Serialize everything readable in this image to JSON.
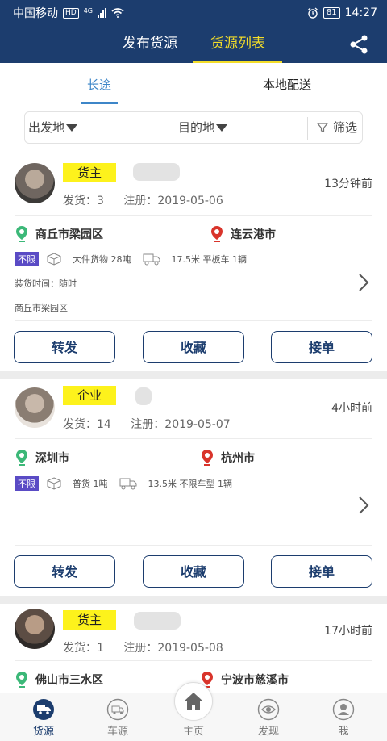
{
  "status_bar": {
    "carrier": "中国移动",
    "hd": "HD",
    "network": "4G",
    "battery": "81",
    "time": "14:27"
  },
  "header": {
    "tabs": [
      {
        "label": "发布货源"
      },
      {
        "label": "货源列表"
      }
    ],
    "active_tab": "货源列表",
    "share_icon": "share-icon"
  },
  "subtabs": [
    {
      "label": "长途"
    },
    {
      "label": "本地配送"
    }
  ],
  "filter": {
    "origin": "出发地",
    "destination": "目的地",
    "screen": "筛选"
  },
  "cards": [
    {
      "tag": "货主",
      "shipments_label": "发货：",
      "shipments": "3",
      "registered_label": "注册：",
      "registered": "2019-05-06",
      "time_ago": "13分钟前",
      "from": "商丘市梁园区",
      "to": "连云港市",
      "limit_badge": "不限",
      "cargo": "大件货物 28吨",
      "vehicle": "17.5米 平板车 1辆",
      "loading_time": "装货时间：随时",
      "address": "商丘市梁园区",
      "buttons": [
        "转发",
        "收藏",
        "接单"
      ]
    },
    {
      "tag": "企业",
      "shipments_label": "发货：",
      "shipments": "14",
      "registered_label": "注册：",
      "registered": "2019-05-07",
      "time_ago": "4小时前",
      "from": "深圳市",
      "to": "杭州市",
      "limit_badge": "不限",
      "cargo": "普货 1吨",
      "vehicle": "13.5米 不限车型 1辆",
      "buttons": [
        "转发",
        "收藏",
        "接单"
      ]
    },
    {
      "tag": "货主",
      "shipments_label": "发货：",
      "shipments": "1",
      "registered_label": "注册：",
      "registered": "2019-05-08",
      "time_ago": "17小时前",
      "from": "佛山市三水区",
      "to": "宁波市慈溪市"
    }
  ],
  "bottom_nav": [
    {
      "label": "货源",
      "icon": "truck-icon",
      "active": true
    },
    {
      "label": "车源",
      "icon": "van-icon",
      "active": false
    },
    {
      "label": "主页",
      "icon": "home-icon",
      "active": false
    },
    {
      "label": "发现",
      "icon": "eye-icon",
      "active": false
    },
    {
      "label": "我",
      "icon": "user-icon",
      "active": false
    }
  ],
  "colors": {
    "primary": "#1c3d6e",
    "accent": "#f3dd29",
    "tab_active": "#3d86c8",
    "tag_bg": "#fdf21c",
    "badge": "#5a4bc5",
    "pin_green": "#3cb878",
    "pin_red": "#d9342b"
  }
}
